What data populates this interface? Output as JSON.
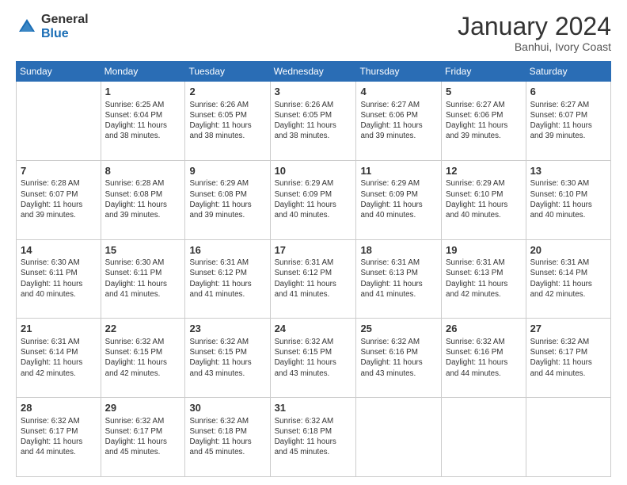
{
  "logo": {
    "general": "General",
    "blue": "Blue"
  },
  "header": {
    "title": "January 2024",
    "subtitle": "Banhui, Ivory Coast"
  },
  "weekdays": [
    "Sunday",
    "Monday",
    "Tuesday",
    "Wednesday",
    "Thursday",
    "Friday",
    "Saturday"
  ],
  "weeks": [
    [
      {
        "day": "",
        "info": ""
      },
      {
        "day": "1",
        "info": "Sunrise: 6:25 AM\nSunset: 6:04 PM\nDaylight: 11 hours\nand 38 minutes."
      },
      {
        "day": "2",
        "info": "Sunrise: 6:26 AM\nSunset: 6:05 PM\nDaylight: 11 hours\nand 38 minutes."
      },
      {
        "day": "3",
        "info": "Sunrise: 6:26 AM\nSunset: 6:05 PM\nDaylight: 11 hours\nand 38 minutes."
      },
      {
        "day": "4",
        "info": "Sunrise: 6:27 AM\nSunset: 6:06 PM\nDaylight: 11 hours\nand 39 minutes."
      },
      {
        "day": "5",
        "info": "Sunrise: 6:27 AM\nSunset: 6:06 PM\nDaylight: 11 hours\nand 39 minutes."
      },
      {
        "day": "6",
        "info": "Sunrise: 6:27 AM\nSunset: 6:07 PM\nDaylight: 11 hours\nand 39 minutes."
      }
    ],
    [
      {
        "day": "7",
        "info": "Sunrise: 6:28 AM\nSunset: 6:07 PM\nDaylight: 11 hours\nand 39 minutes."
      },
      {
        "day": "8",
        "info": "Sunrise: 6:28 AM\nSunset: 6:08 PM\nDaylight: 11 hours\nand 39 minutes."
      },
      {
        "day": "9",
        "info": "Sunrise: 6:29 AM\nSunset: 6:08 PM\nDaylight: 11 hours\nand 39 minutes."
      },
      {
        "day": "10",
        "info": "Sunrise: 6:29 AM\nSunset: 6:09 PM\nDaylight: 11 hours\nand 40 minutes."
      },
      {
        "day": "11",
        "info": "Sunrise: 6:29 AM\nSunset: 6:09 PM\nDaylight: 11 hours\nand 40 minutes."
      },
      {
        "day": "12",
        "info": "Sunrise: 6:29 AM\nSunset: 6:10 PM\nDaylight: 11 hours\nand 40 minutes."
      },
      {
        "day": "13",
        "info": "Sunrise: 6:30 AM\nSunset: 6:10 PM\nDaylight: 11 hours\nand 40 minutes."
      }
    ],
    [
      {
        "day": "14",
        "info": "Sunrise: 6:30 AM\nSunset: 6:11 PM\nDaylight: 11 hours\nand 40 minutes."
      },
      {
        "day": "15",
        "info": "Sunrise: 6:30 AM\nSunset: 6:11 PM\nDaylight: 11 hours\nand 41 minutes."
      },
      {
        "day": "16",
        "info": "Sunrise: 6:31 AM\nSunset: 6:12 PM\nDaylight: 11 hours\nand 41 minutes."
      },
      {
        "day": "17",
        "info": "Sunrise: 6:31 AM\nSunset: 6:12 PM\nDaylight: 11 hours\nand 41 minutes."
      },
      {
        "day": "18",
        "info": "Sunrise: 6:31 AM\nSunset: 6:13 PM\nDaylight: 11 hours\nand 41 minutes."
      },
      {
        "day": "19",
        "info": "Sunrise: 6:31 AM\nSunset: 6:13 PM\nDaylight: 11 hours\nand 42 minutes."
      },
      {
        "day": "20",
        "info": "Sunrise: 6:31 AM\nSunset: 6:14 PM\nDaylight: 11 hours\nand 42 minutes."
      }
    ],
    [
      {
        "day": "21",
        "info": "Sunrise: 6:31 AM\nSunset: 6:14 PM\nDaylight: 11 hours\nand 42 minutes."
      },
      {
        "day": "22",
        "info": "Sunrise: 6:32 AM\nSunset: 6:15 PM\nDaylight: 11 hours\nand 42 minutes."
      },
      {
        "day": "23",
        "info": "Sunrise: 6:32 AM\nSunset: 6:15 PM\nDaylight: 11 hours\nand 43 minutes."
      },
      {
        "day": "24",
        "info": "Sunrise: 6:32 AM\nSunset: 6:15 PM\nDaylight: 11 hours\nand 43 minutes."
      },
      {
        "day": "25",
        "info": "Sunrise: 6:32 AM\nSunset: 6:16 PM\nDaylight: 11 hours\nand 43 minutes."
      },
      {
        "day": "26",
        "info": "Sunrise: 6:32 AM\nSunset: 6:16 PM\nDaylight: 11 hours\nand 44 minutes."
      },
      {
        "day": "27",
        "info": "Sunrise: 6:32 AM\nSunset: 6:17 PM\nDaylight: 11 hours\nand 44 minutes."
      }
    ],
    [
      {
        "day": "28",
        "info": "Sunrise: 6:32 AM\nSunset: 6:17 PM\nDaylight: 11 hours\nand 44 minutes."
      },
      {
        "day": "29",
        "info": "Sunrise: 6:32 AM\nSunset: 6:17 PM\nDaylight: 11 hours\nand 45 minutes."
      },
      {
        "day": "30",
        "info": "Sunrise: 6:32 AM\nSunset: 6:18 PM\nDaylight: 11 hours\nand 45 minutes."
      },
      {
        "day": "31",
        "info": "Sunrise: 6:32 AM\nSunset: 6:18 PM\nDaylight: 11 hours\nand 45 minutes."
      },
      {
        "day": "",
        "info": ""
      },
      {
        "day": "",
        "info": ""
      },
      {
        "day": "",
        "info": ""
      }
    ]
  ]
}
